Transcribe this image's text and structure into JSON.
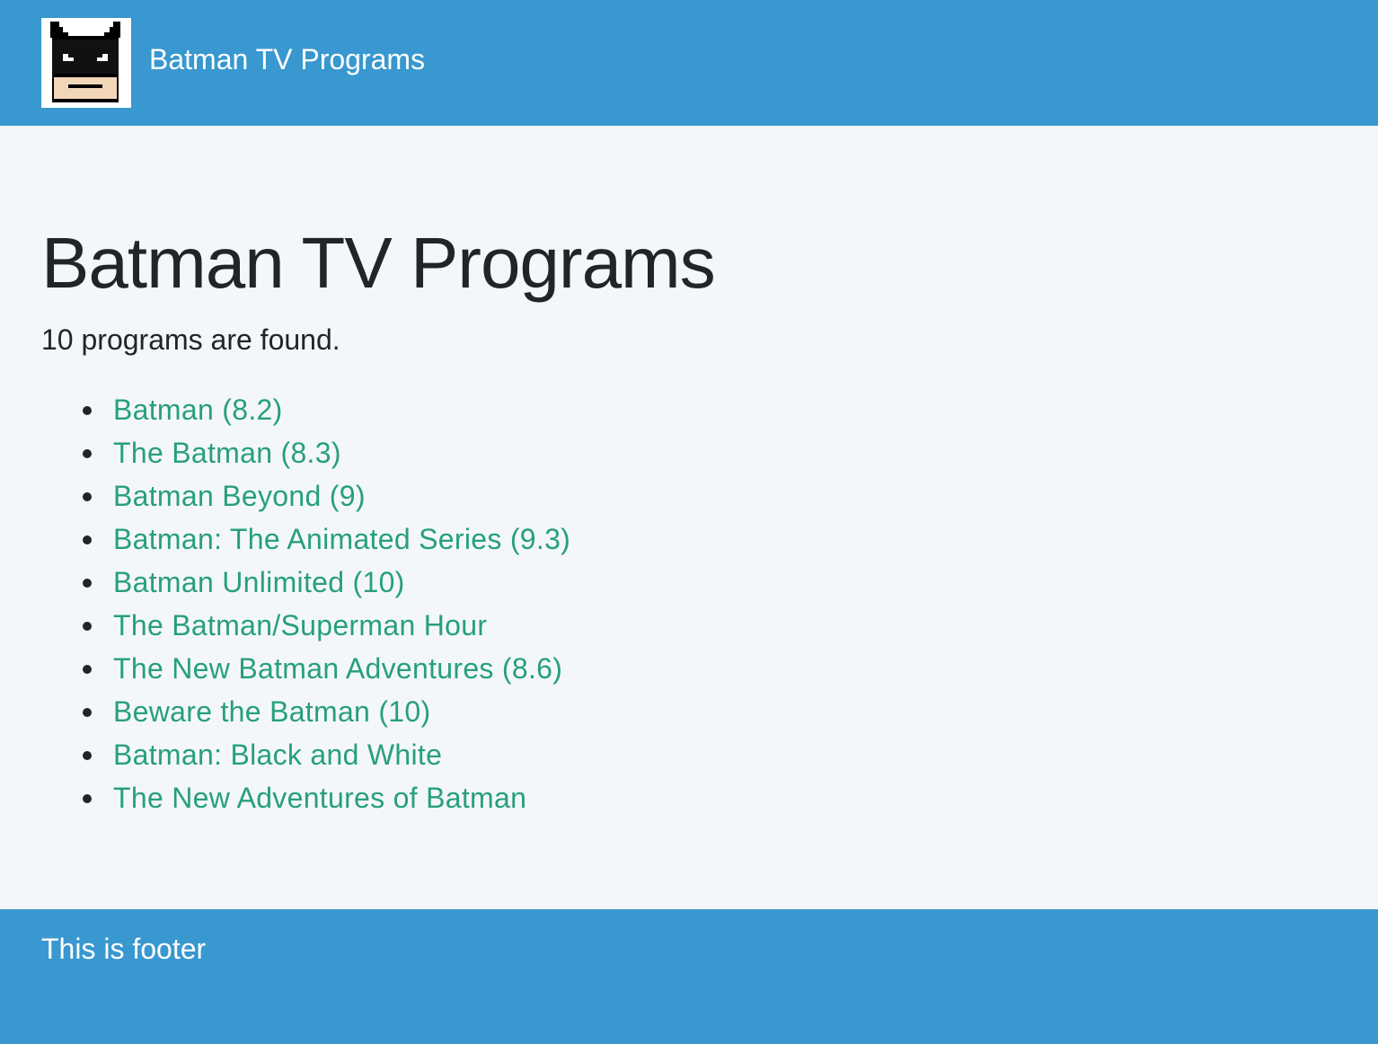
{
  "header": {
    "logo_icon": "batman-pixel-logo-icon",
    "brand_title": "Batman TV Programs",
    "background_color": "#3898cf"
  },
  "main": {
    "title": "Batman TV Programs",
    "count_text": "10 programs are found.",
    "link_color": "#27a07a",
    "programs": [
      {
        "label": "Batman (8.2)"
      },
      {
        "label": "The Batman (8.3)"
      },
      {
        "label": "Batman Beyond (9)"
      },
      {
        "label": "Batman: The Animated Series (9.3)"
      },
      {
        "label": "Batman Unlimited (10)"
      },
      {
        "label": "The Batman/Superman Hour"
      },
      {
        "label": "The New Batman Adventures (8.6)"
      },
      {
        "label": "Beware the Batman (10)"
      },
      {
        "label": "Batman: Black and White"
      },
      {
        "label": "The New Adventures of Batman"
      }
    ]
  },
  "footer": {
    "text": "This is footer"
  }
}
